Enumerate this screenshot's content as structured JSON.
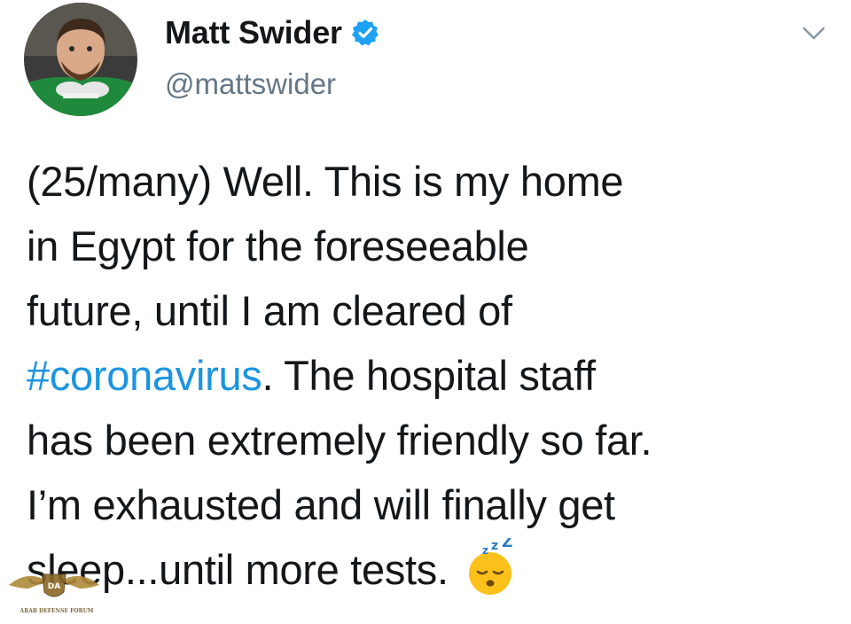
{
  "tweet": {
    "author": {
      "display_name": "Matt Swider",
      "handle": "@mattswider",
      "verified": true,
      "avatar_icon": "profile-photo"
    },
    "menu_icon": "chevron-down-icon",
    "text_lines": [
      "(25/many) Well. This is my home",
      "in Egypt for the foreseeable",
      "future, until I am cleared of"
    ],
    "hashtag": "#coronavirus",
    "line4_rest": ". The hospital staff",
    "text_lines_after": [
      "has been extremely friendly so far.",
      "I’m exhausted and will finally get"
    ],
    "last_line": "sleep...until more tests.",
    "emoji": "sleeping-face-icon"
  },
  "watermark": {
    "label": "ARAB DEFENSE FORUM",
    "icon": "eagle-logo"
  },
  "colors": {
    "text": "#14171a",
    "secondary": "#657786",
    "link": "#1b95e0",
    "verified": "#1da1f2"
  }
}
